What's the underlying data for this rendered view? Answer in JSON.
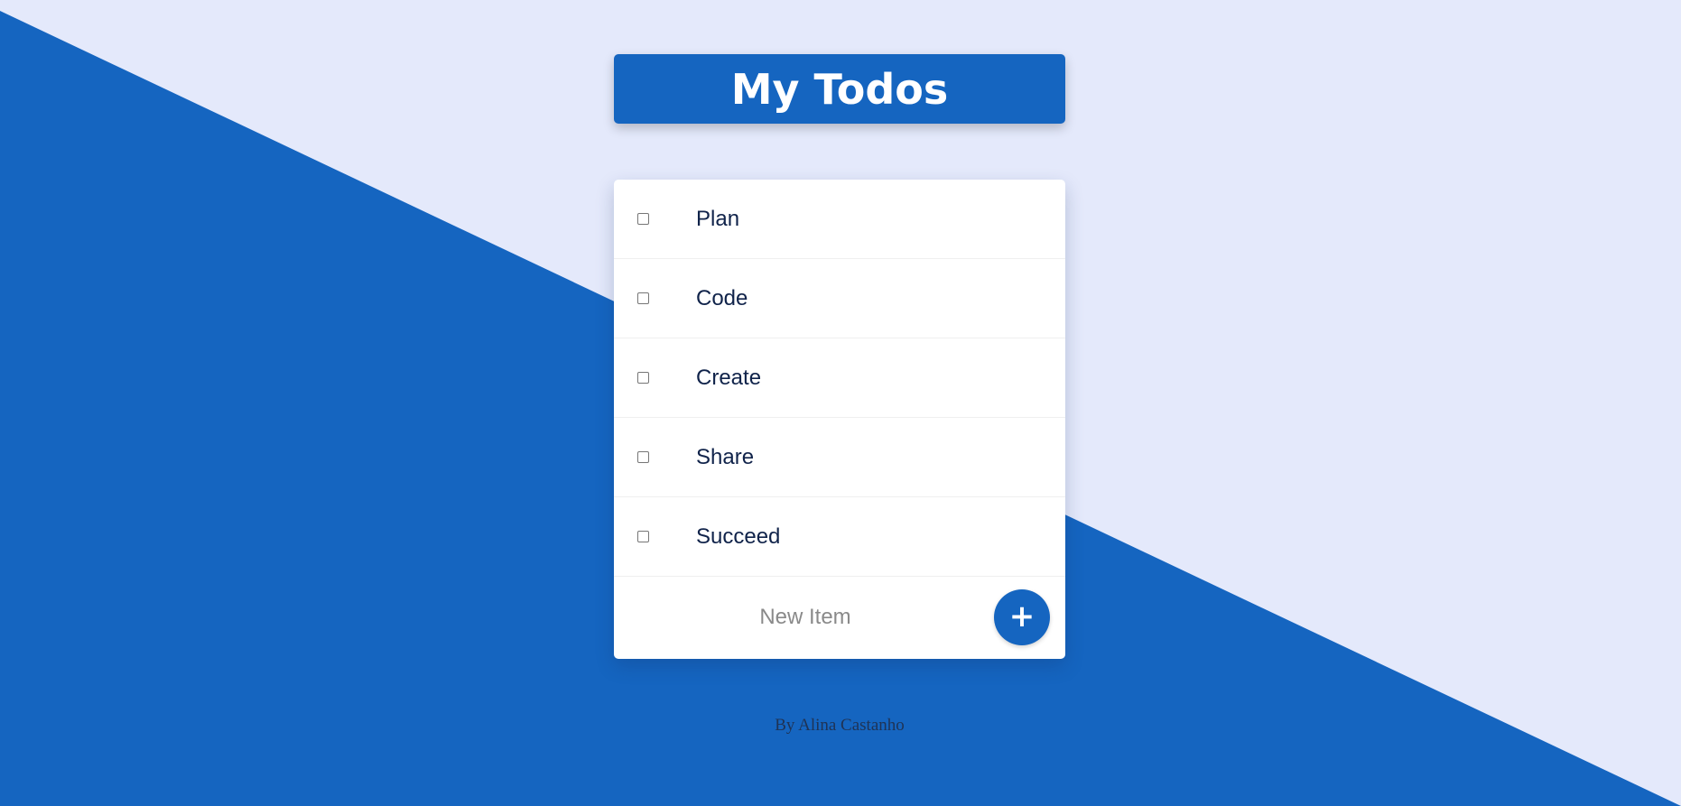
{
  "header": {
    "title": "My Todos"
  },
  "todos": {
    "items": [
      {
        "label": "Plan",
        "checked": false
      },
      {
        "label": "Code",
        "checked": false
      },
      {
        "label": "Create",
        "checked": false
      },
      {
        "label": "Share",
        "checked": false
      },
      {
        "label": "Succeed",
        "checked": false
      }
    ],
    "new_item_placeholder": "New Item",
    "add_button_label": "+"
  },
  "footer": {
    "credit": "By Alina Castanho"
  },
  "colors": {
    "accent": "#1565c0",
    "background_light": "#e4e9fb",
    "card": "#ffffff",
    "item_text": "#10234a"
  }
}
